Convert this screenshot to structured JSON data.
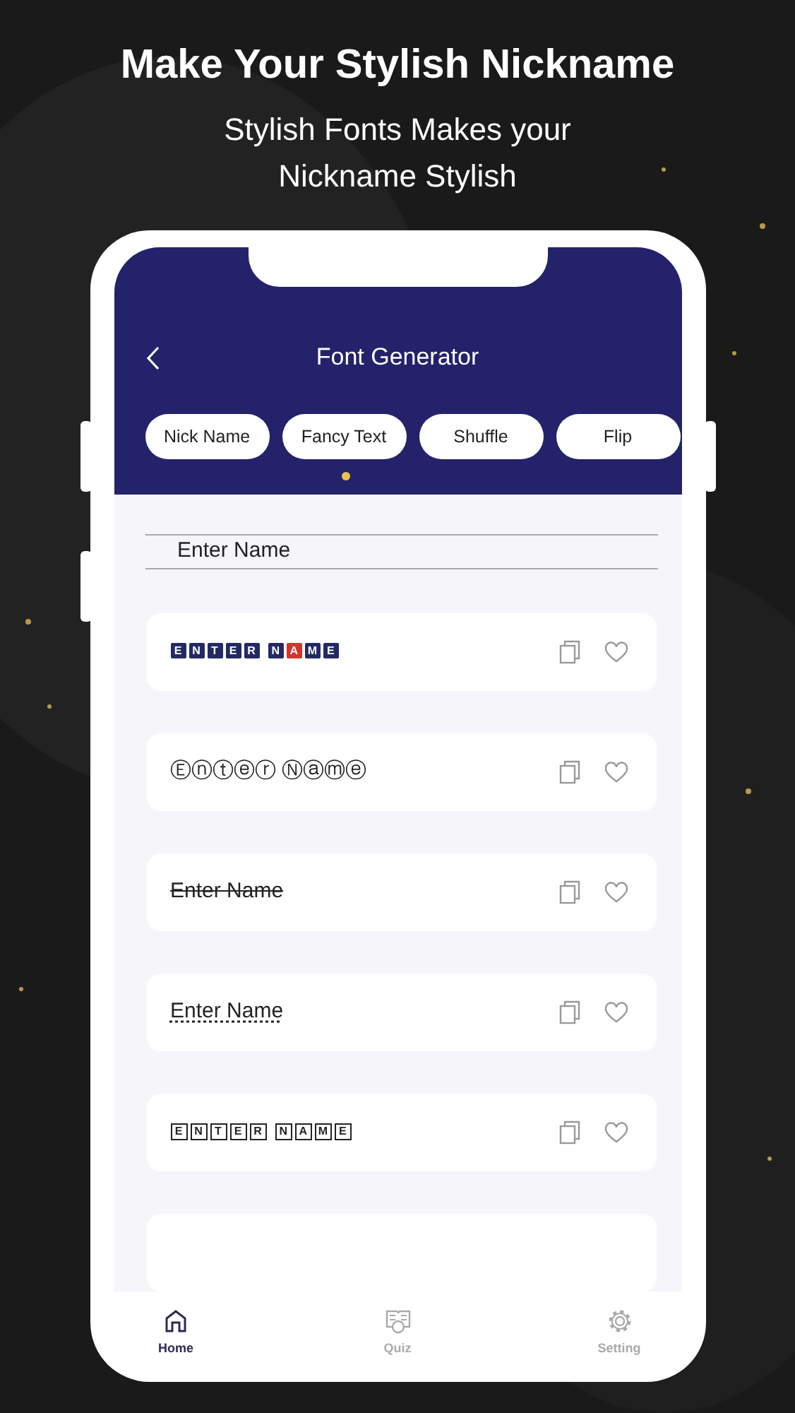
{
  "headline": "Make Your Stylish Nickname",
  "subheadline": "Stylish Fonts Makes your Nickname Stylish",
  "app_bar": {
    "title": "Font Generator"
  },
  "tabs": [
    {
      "label": "Nick Name"
    },
    {
      "label": "Fancy Text"
    },
    {
      "label": "Shuffle"
    },
    {
      "label": "Flip"
    }
  ],
  "name_field": {
    "placeholder": "Enter Name"
  },
  "results": [
    {
      "kind": "tiles",
      "words": [
        [
          {
            "char": "E",
            "color": "#232a63"
          },
          {
            "char": "N",
            "color": "#232a63"
          },
          {
            "char": "T",
            "color": "#232a63"
          },
          {
            "char": "E",
            "color": "#232a63"
          },
          {
            "char": "R",
            "color": "#232a63"
          }
        ],
        [
          {
            "char": "N",
            "color": "#232a63"
          },
          {
            "char": "A",
            "color": "#d9312b"
          },
          {
            "char": "M",
            "color": "#232a63"
          },
          {
            "char": "E",
            "color": "#232a63"
          }
        ]
      ]
    },
    {
      "kind": "plain",
      "text": "Ⓔⓝⓣⓔⓡ Ⓝⓐⓜⓔ"
    },
    {
      "kind": "strike",
      "text": "Enter Name"
    },
    {
      "kind": "dotted",
      "text": "Enter Name"
    },
    {
      "kind": "boxed",
      "words": [
        [
          "E",
          "N",
          "T",
          "E",
          "R"
        ],
        [
          "N",
          "A",
          "M",
          "E"
        ]
      ]
    }
  ],
  "bottom_nav": [
    {
      "label": "Home",
      "selected": true
    },
    {
      "label": "Quiz",
      "selected": false
    },
    {
      "label": "Setting",
      "selected": false
    }
  ]
}
